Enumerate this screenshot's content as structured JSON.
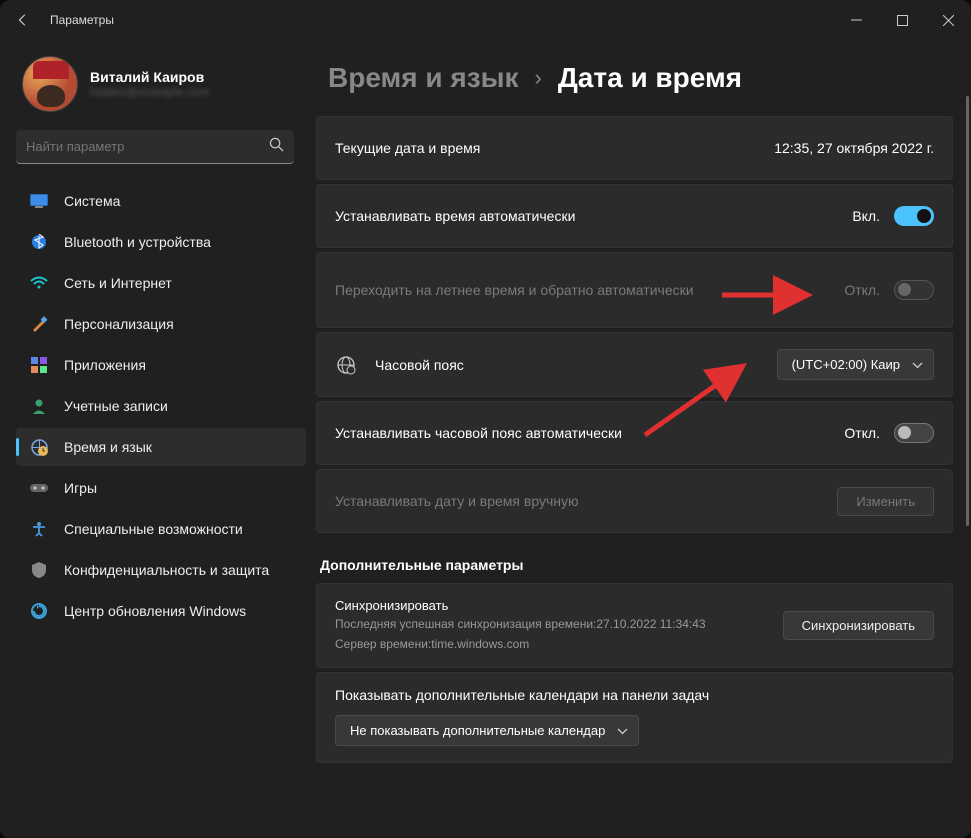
{
  "titlebar": {
    "app_title": "Параметры"
  },
  "profile": {
    "name": "Виталий Каиров",
    "email": "hidden@example.com"
  },
  "search": {
    "placeholder": "Найти параметр"
  },
  "nav": {
    "items": [
      {
        "label": "Система"
      },
      {
        "label": "Bluetooth и устройства"
      },
      {
        "label": "Сеть и Интернет"
      },
      {
        "label": "Персонализация"
      },
      {
        "label": "Приложения"
      },
      {
        "label": "Учетные записи"
      },
      {
        "label": "Время и язык"
      },
      {
        "label": "Игры"
      },
      {
        "label": "Специальные возможности"
      },
      {
        "label": "Конфиденциальность и защита"
      },
      {
        "label": "Центр обновления Windows"
      }
    ]
  },
  "breadcrumb": {
    "parent": "Время и язык",
    "current": "Дата и время"
  },
  "rows": {
    "current": {
      "label": "Текущие дата и время",
      "value": "12:35, 27 октября 2022 г."
    },
    "auto_time": {
      "label": "Устанавливать время автоматически",
      "state_label": "Вкл."
    },
    "dst": {
      "label": "Переходить на летнее время и обратно автоматически",
      "state_label": "Откл."
    },
    "timezone": {
      "label": "Часовой пояс",
      "value": "(UTC+02:00) Каир"
    },
    "auto_tz": {
      "label": "Устанавливать часовой пояс автоматически",
      "state_label": "Откл."
    },
    "manual": {
      "label": "Устанавливать дату и время вручную",
      "button": "Изменить"
    }
  },
  "additional": {
    "title": "Дополнительные параметры",
    "sync": {
      "title": "Синхронизировать",
      "line1": "Последняя успешная синхронизация времени:27.10.2022 11:34:43",
      "line2": "Сервер времени:time.windows.com",
      "button": "Синхронизировать"
    },
    "calendars": {
      "label": "Показывать дополнительные календари на панели задач",
      "value": "Не показывать дополнительные календар"
    }
  },
  "colors": {
    "accent": "#4cc2ff",
    "arrow": "#e03030"
  }
}
